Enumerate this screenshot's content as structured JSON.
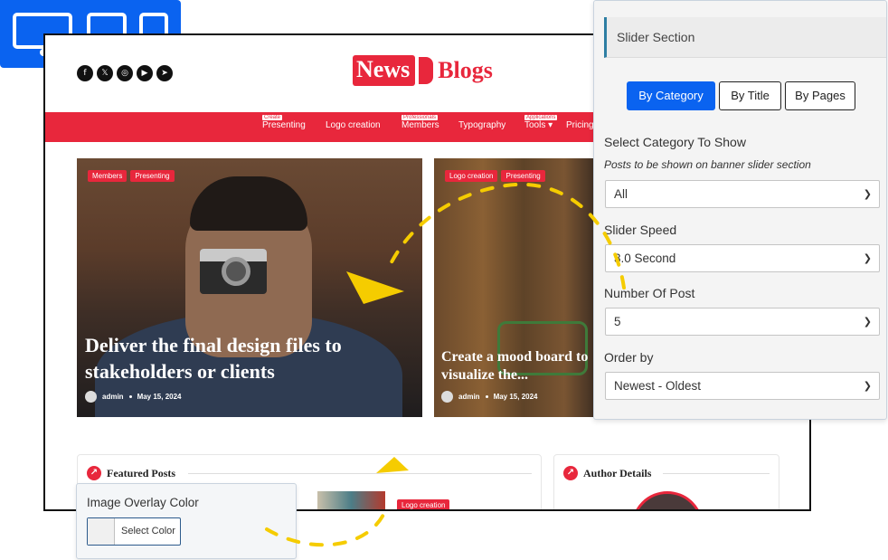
{
  "device_switcher": {
    "devices": [
      "desktop-icon",
      "tablet-icon",
      "mobile-icon"
    ],
    "color": "#0a63f0"
  },
  "site": {
    "social_icons": [
      "facebook-icon",
      "x-icon",
      "instagram-icon",
      "youtube-icon",
      "telegram-icon"
    ],
    "logo": {
      "word1": "News",
      "word2": "Blogs",
      "color": "#e8273c"
    },
    "nav": [
      {
        "label": "Presenting",
        "tag": "Create"
      },
      {
        "label": "Logo creation",
        "tag": ""
      },
      {
        "label": "Members",
        "tag": "Professionals"
      },
      {
        "label": "Typography",
        "tag": ""
      },
      {
        "label": "Tools ▾",
        "tag": "Applications"
      },
      {
        "label": "Pricing",
        "tag": ""
      }
    ],
    "hero_main": {
      "badges": [
        "Members",
        "Presenting"
      ],
      "title": "Deliver the final design files to stakeholders or clients",
      "author": "admin",
      "date": "May 15, 2024"
    },
    "hero_side": {
      "badges": [
        "Logo creation",
        "Presenting"
      ],
      "title": "Create a mood board to visualize the...",
      "author": "admin",
      "date": "May 15, 2024"
    },
    "featured": {
      "heading": "Featured Posts",
      "badge": "Logo creation"
    },
    "author_details": {
      "heading": "Author Details"
    }
  },
  "panel": {
    "title": "Slider Section",
    "tabs": [
      {
        "label": "By Category",
        "active": true
      },
      {
        "label": "By Title",
        "active": false
      },
      {
        "label": "By Pages",
        "active": false
      }
    ],
    "category_label": "Select Category To Show",
    "category_help": "Posts to be shown on banner slider section",
    "category_value": "All",
    "speed_label": "Slider Speed",
    "speed_value": "3.0 Second",
    "count_label": "Number Of Post",
    "count_value": "5",
    "order_label": "Order by",
    "order_value": "Newest - Oldest"
  },
  "overlay": {
    "title": "Image Overlay Color",
    "button": "Select Color"
  },
  "accent_colors": {
    "brand": "#e8273c",
    "primary": "#0a63f0",
    "arrow": "#f5cc00"
  }
}
